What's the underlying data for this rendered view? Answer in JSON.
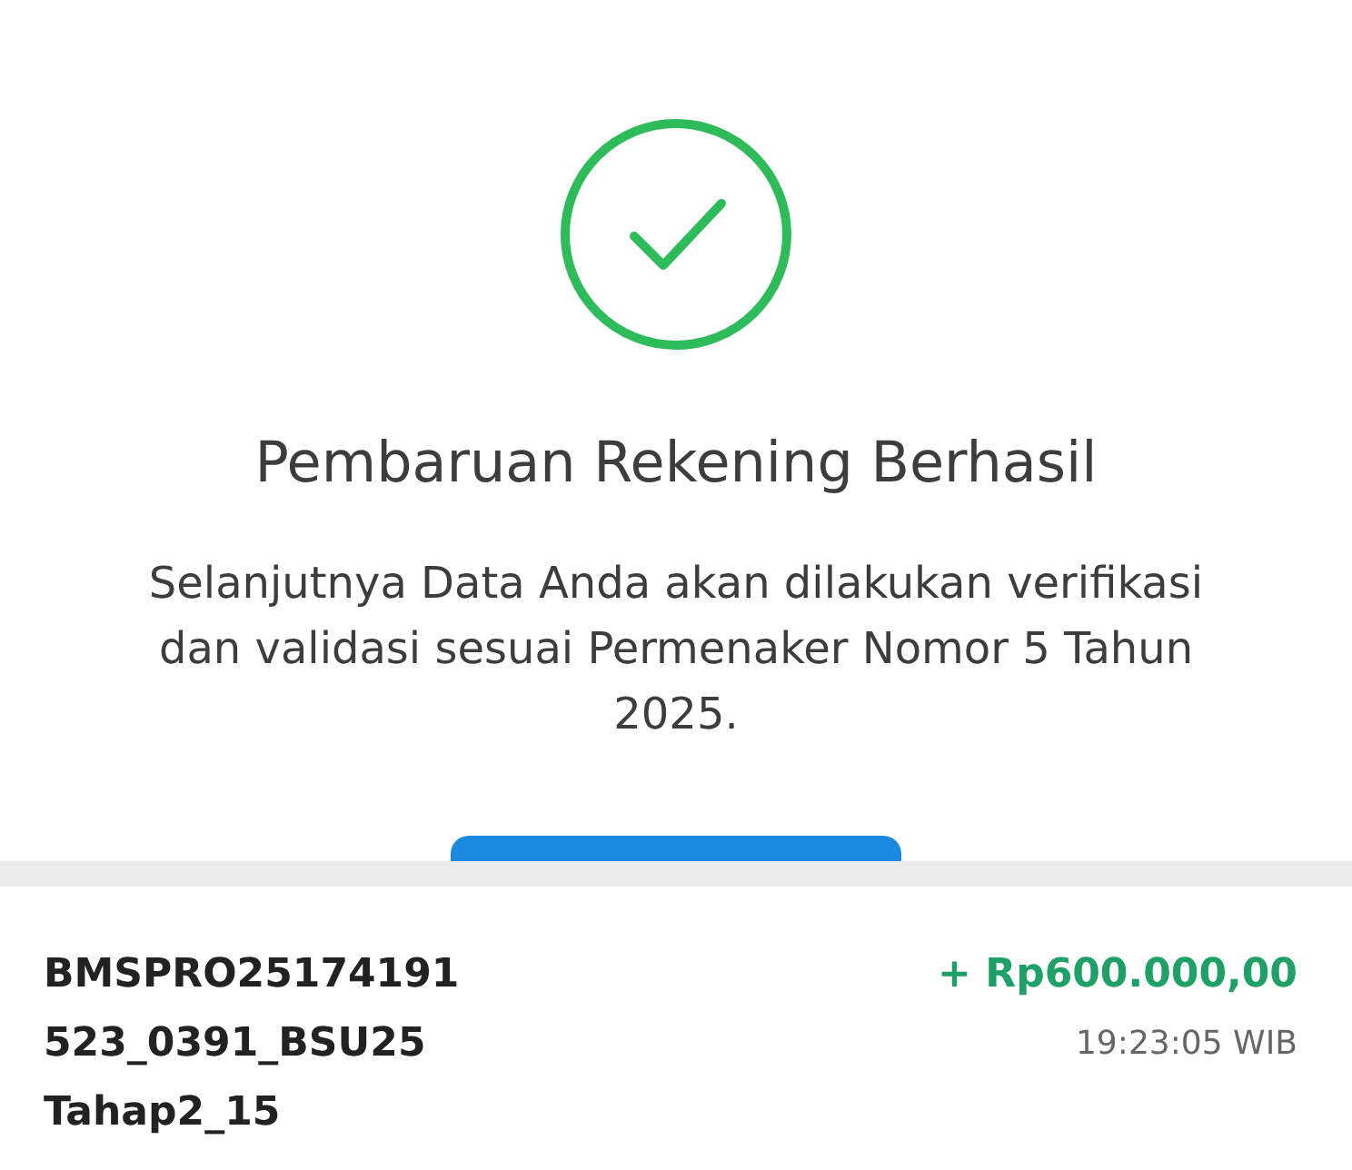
{
  "success": {
    "title": "Pembaruan Rekening Berhasil",
    "message": "Selanjutnya Data Anda akan dilakukan verifikasi dan validasi sesuai Permenaker Nomor 5 Tahun 2025."
  },
  "transaction": {
    "reference_lines": [
      "BMSPRO25174191",
      "523_0391_BSU25",
      "Tahap2_15"
    ],
    "amount": "+ Rp600.000,00",
    "time": "19:23:05 WIB"
  }
}
